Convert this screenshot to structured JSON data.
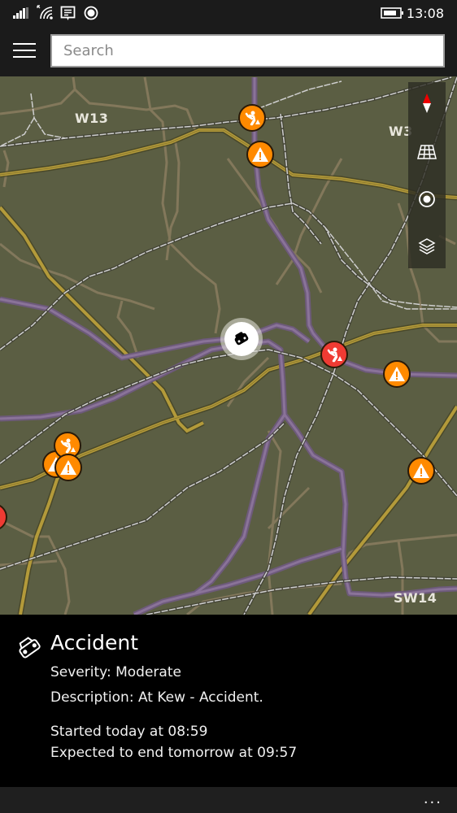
{
  "status_bar": {
    "time": "13:08",
    "icons": [
      "signal-icon",
      "wifi-icon",
      "message-icon",
      "location-icon",
      "battery-icon"
    ]
  },
  "header": {
    "menu_icon": "hamburger-icon",
    "search": {
      "placeholder": "Search",
      "value": ""
    }
  },
  "map": {
    "area_labels": [
      "W13",
      "W3",
      "SW14"
    ],
    "controls": [
      {
        "name": "compass",
        "icon": "compass-icon"
      },
      {
        "name": "3d-view",
        "icon": "grid-icon"
      },
      {
        "name": "my-location",
        "icon": "target-icon"
      },
      {
        "name": "map-layers",
        "icon": "layers-icon"
      }
    ],
    "incidents": [
      {
        "type": "roadworks",
        "color": "orange"
      },
      {
        "type": "warning",
        "color": "orange"
      },
      {
        "type": "accident",
        "color": "white",
        "selected": true
      },
      {
        "type": "roadworks",
        "color": "red"
      },
      {
        "type": "warning",
        "color": "orange"
      },
      {
        "type": "roadworks",
        "color": "orange"
      },
      {
        "type": "warning",
        "color": "orange"
      },
      {
        "type": "warning",
        "color": "orange"
      },
      {
        "type": "warning",
        "color": "orange"
      },
      {
        "type": "incident",
        "color": "red"
      }
    ],
    "colors": {
      "land": "#5b5e43",
      "major_road": "#7a5f8a",
      "secondary_road": "#b39a3a",
      "minor_road": "#8a7d60",
      "rail": "#c8c8c8",
      "incident_orange": "#ff8a00",
      "incident_red": "#ef3b33"
    }
  },
  "details": {
    "icon": "accident-icon",
    "title": "Accident",
    "severity": "Severity: Moderate",
    "description": "Description: At Kew - Accident.",
    "started": "Started today at 08:59",
    "expected_end": "Expected to end tomorrow at 09:57"
  },
  "app_bar": {
    "more_label": "..."
  }
}
